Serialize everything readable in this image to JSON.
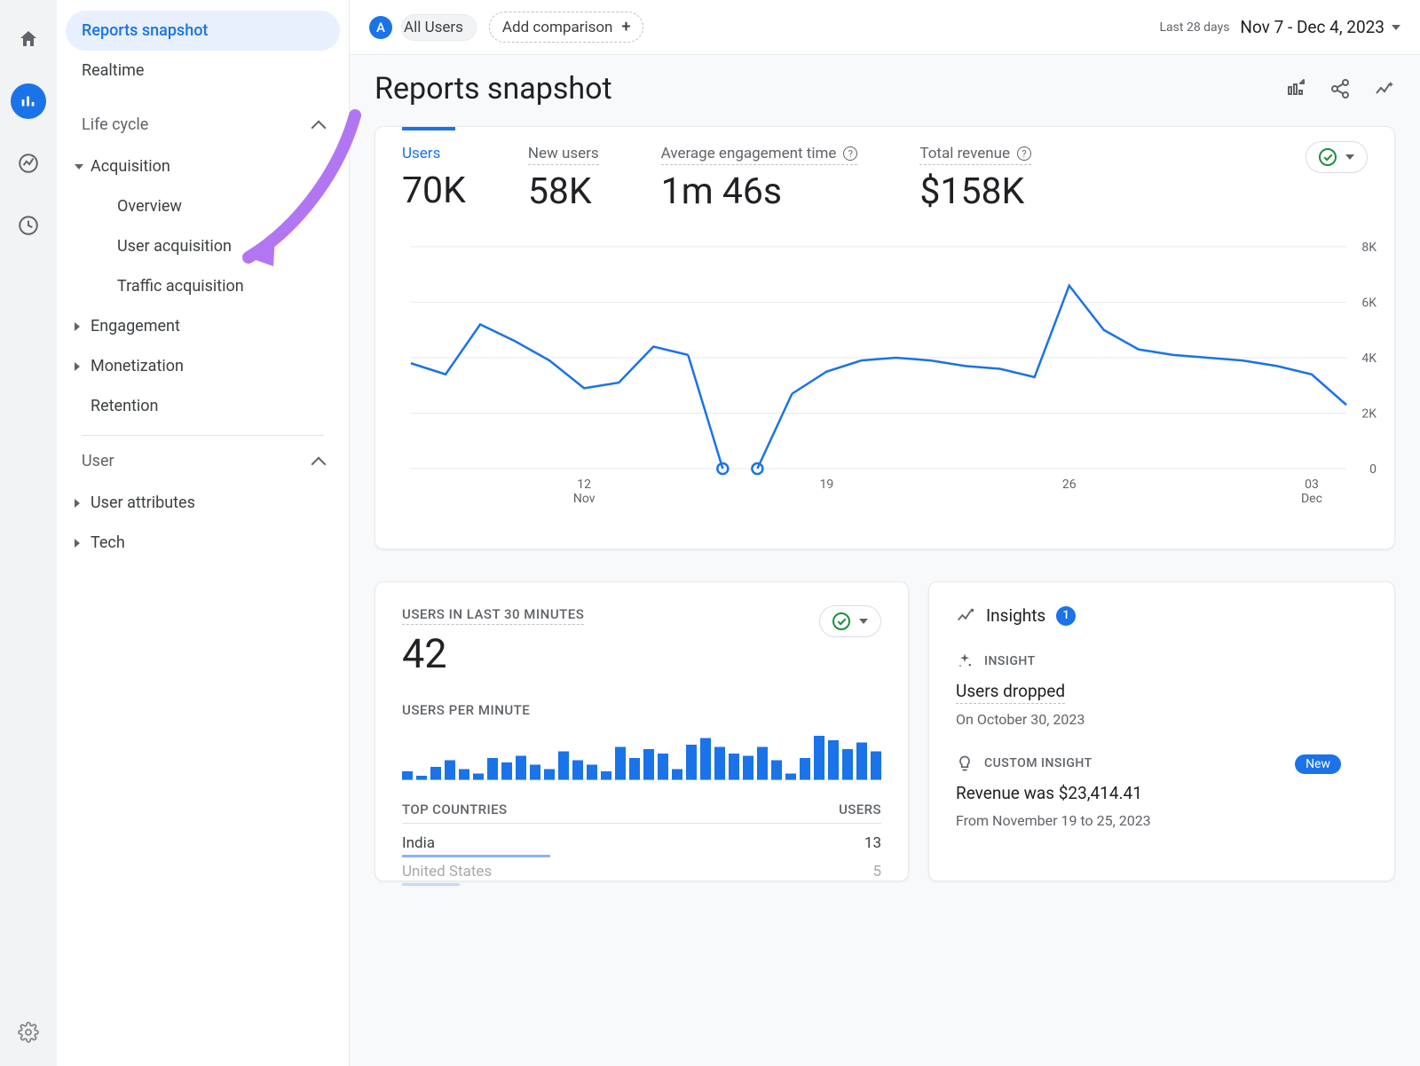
{
  "rail": {
    "icons": [
      "home",
      "bar-chart",
      "trend",
      "target"
    ]
  },
  "sidebar": {
    "primary": [
      {
        "label": "Reports snapshot",
        "active": true
      },
      {
        "label": "Realtime",
        "active": false
      }
    ],
    "sections": [
      {
        "label": "Life cycle",
        "expanded": true,
        "groups": [
          {
            "label": "Acquisition",
            "expanded": true,
            "children": [
              {
                "label": "Overview"
              },
              {
                "label": "User acquisition"
              },
              {
                "label": "Traffic acquisition"
              }
            ]
          },
          {
            "label": "Engagement",
            "expanded": false
          },
          {
            "label": "Monetization",
            "expanded": false
          },
          {
            "label": "Retention",
            "expanded": false,
            "noCaret": true
          }
        ]
      },
      {
        "label": "User",
        "expanded": true,
        "groups": [
          {
            "label": "User attributes",
            "expanded": false
          },
          {
            "label": "Tech",
            "expanded": false
          }
        ]
      }
    ]
  },
  "topbar": {
    "audience_badge": "A",
    "audience_label": "All Users",
    "add_comparison": "Add comparison",
    "date_label": "Last 28 days",
    "date_value": "Nov 7 - Dec 4, 2023"
  },
  "page_title": "Reports snapshot",
  "kpis": [
    {
      "label": "Users",
      "value": "70K",
      "active": true,
      "info": false
    },
    {
      "label": "New users",
      "value": "58K",
      "active": false,
      "info": false
    },
    {
      "label": "Average engagement time",
      "value": "1m 46s",
      "active": false,
      "info": true
    },
    {
      "label": "Total revenue",
      "value": "$158K",
      "active": false,
      "info": true
    }
  ],
  "chart_data": {
    "type": "line",
    "title": "Users over time",
    "xlabel": "",
    "ylabel": "",
    "ylim": [
      0,
      8000
    ],
    "y_ticks": [
      "0",
      "2K",
      "4K",
      "6K",
      "8K"
    ],
    "x_ticks": [
      {
        "pos": 5,
        "label": "12",
        "sub": "Nov"
      },
      {
        "pos": 12,
        "label": "19"
      },
      {
        "pos": 19,
        "label": "26"
      },
      {
        "pos": 26,
        "label": "03",
        "sub": "Dec"
      }
    ],
    "x": [
      7,
      8,
      9,
      10,
      11,
      12,
      13,
      14,
      15,
      16,
      17,
      18,
      19,
      20,
      21,
      22,
      23,
      24,
      25,
      26,
      27,
      28,
      29,
      30,
      1,
      2,
      3,
      4
    ],
    "values": [
      3800,
      3400,
      5200,
      4600,
      3900,
      2900,
      3100,
      4400,
      4100,
      0,
      0,
      2700,
      3500,
      3900,
      4000,
      3900,
      3700,
      3600,
      3300,
      6600,
      5000,
      4300,
      4100,
      4000,
      3900,
      3700,
      3400,
      2300
    ],
    "gap_indices": [
      9,
      10
    ]
  },
  "realtime": {
    "title": "USERS IN LAST 30 MINUTES",
    "value": "42",
    "sub": "USERS PER MINUTE",
    "bars": [
      8,
      4,
      12,
      18,
      10,
      6,
      20,
      16,
      22,
      14,
      10,
      26,
      18,
      14,
      8,
      30,
      20,
      28,
      24,
      10,
      32,
      38,
      30,
      24,
      22,
      30,
      18,
      6,
      20,
      40,
      36,
      28,
      34,
      26
    ],
    "col_left": "TOP COUNTRIES",
    "col_right": "USERS",
    "rows": [
      {
        "country": "India",
        "users": "13",
        "pct": 31
      },
      {
        "country": "United States",
        "users": "5",
        "pct": 12
      }
    ]
  },
  "insights": {
    "header": "Insights",
    "count": "1",
    "items": [
      {
        "type": "INSIGHT",
        "icon": "sparkle",
        "title": "Users dropped",
        "sub": "On October 30, 2023"
      },
      {
        "type": "CUSTOM INSIGHT",
        "icon": "bulb",
        "title": "Revenue was $23,414.41",
        "sub": "From November 19 to 25, 2023",
        "badge": "New"
      }
    ]
  }
}
